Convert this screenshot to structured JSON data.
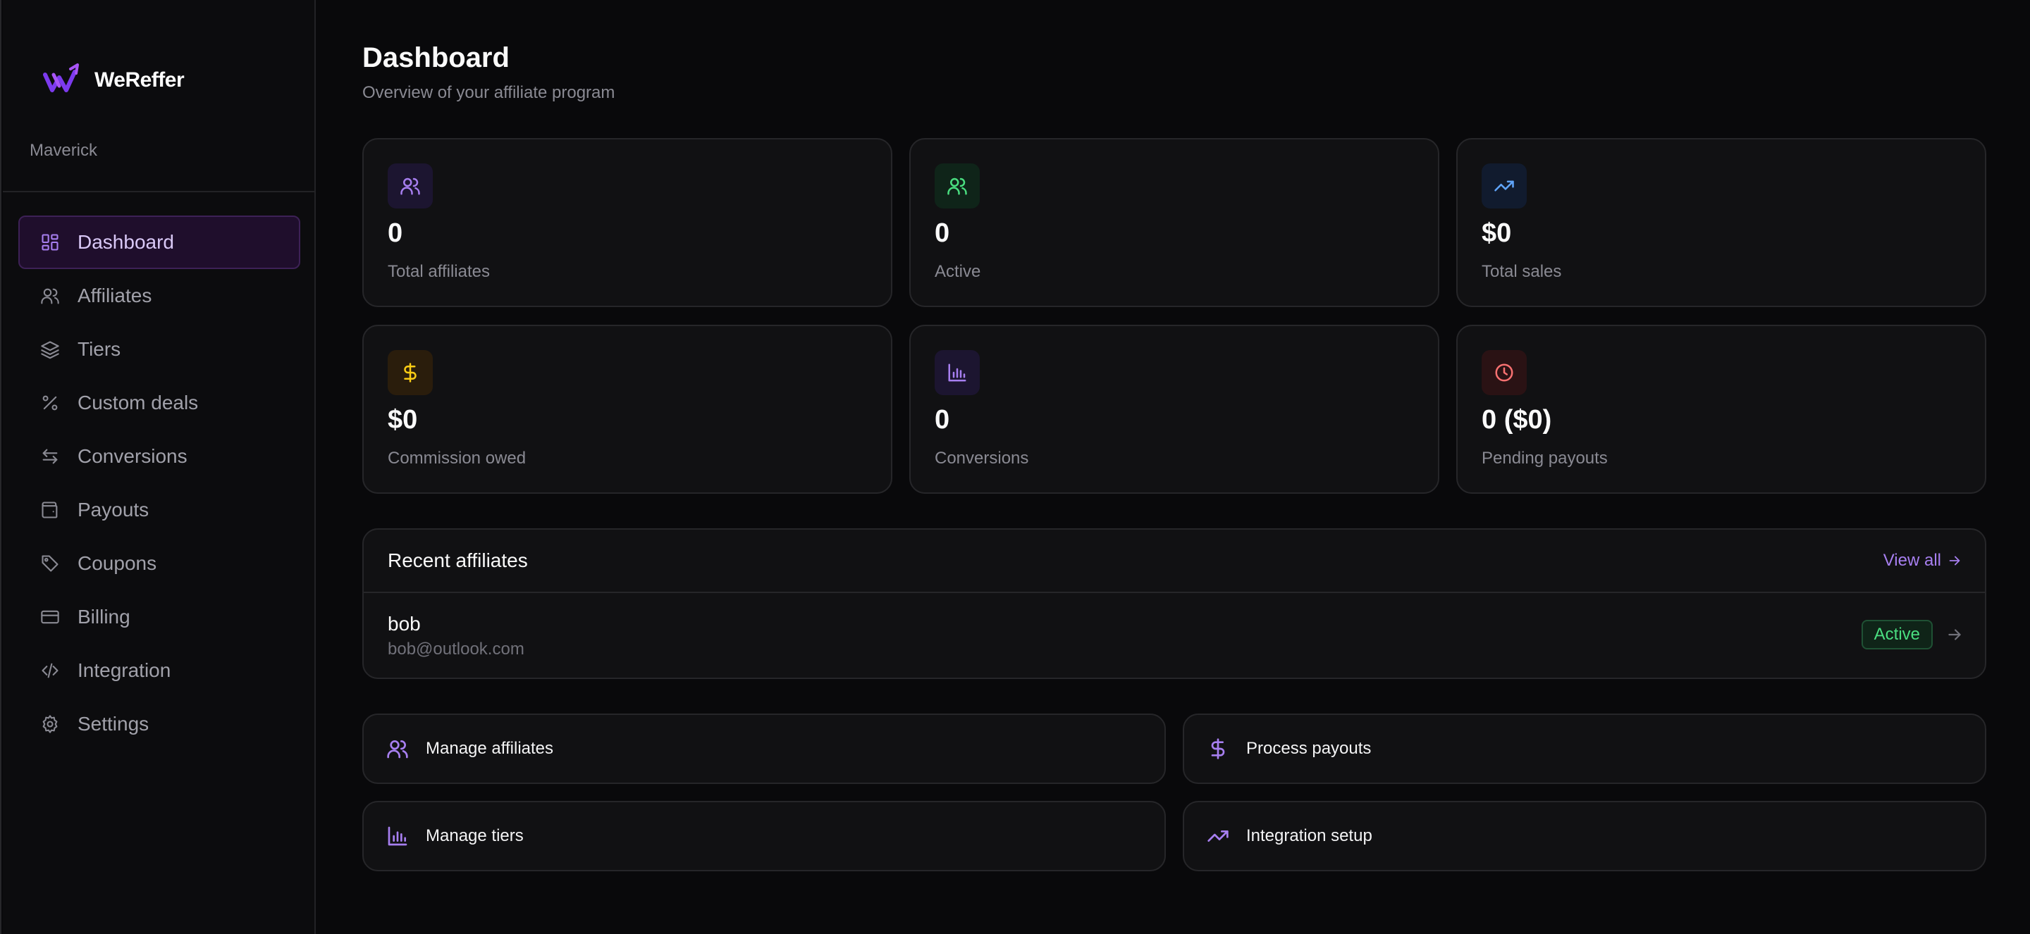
{
  "brand": {
    "name": "WeReffer",
    "accent": "#a77ff0"
  },
  "sidebar": {
    "workspace": "Maverick",
    "items": [
      {
        "label": "Dashboard",
        "icon": "layout-grid-icon",
        "active": true
      },
      {
        "label": "Affiliates",
        "icon": "users-icon"
      },
      {
        "label": "Tiers",
        "icon": "layers-icon"
      },
      {
        "label": "Custom deals",
        "icon": "percent-icon"
      },
      {
        "label": "Conversions",
        "icon": "arrows-exchange-icon"
      },
      {
        "label": "Payouts",
        "icon": "wallet-icon"
      },
      {
        "label": "Coupons",
        "icon": "tag-icon"
      },
      {
        "label": "Billing",
        "icon": "credit-card-icon"
      },
      {
        "label": "Integration",
        "icon": "code-icon"
      },
      {
        "label": "Settings",
        "icon": "gear-icon"
      }
    ]
  },
  "header": {
    "title": "Dashboard",
    "subtitle": "Overview of your affiliate program"
  },
  "stats": [
    {
      "value": "0",
      "label": "Total affiliates",
      "icon": "users-icon",
      "color": "#a77ff0"
    },
    {
      "value": "0",
      "label": "Active",
      "icon": "users-icon",
      "color": "#4ade80"
    },
    {
      "value": "$0",
      "label": "Total sales",
      "icon": "trending-up-icon",
      "color": "#60a5fa"
    },
    {
      "value": "$0",
      "label": "Commission owed",
      "icon": "dollar-icon",
      "color": "#facc15"
    },
    {
      "value": "0",
      "label": "Conversions",
      "icon": "bar-chart-icon",
      "color": "#a77ff0"
    },
    {
      "value": "0 ($0)",
      "label": "Pending payouts",
      "icon": "clock-icon",
      "color": "#f87171"
    }
  ],
  "recent": {
    "title": "Recent affiliates",
    "view_all": "View all",
    "rows": [
      {
        "name": "bob",
        "email": "bob@outlook.com",
        "status": "Active"
      }
    ]
  },
  "actions": [
    {
      "label": "Manage affiliates",
      "icon": "users-icon"
    },
    {
      "label": "Process payouts",
      "icon": "dollar-icon"
    },
    {
      "label": "Manage tiers",
      "icon": "bar-chart-icon"
    },
    {
      "label": "Integration setup",
      "icon": "trending-up-icon"
    }
  ]
}
